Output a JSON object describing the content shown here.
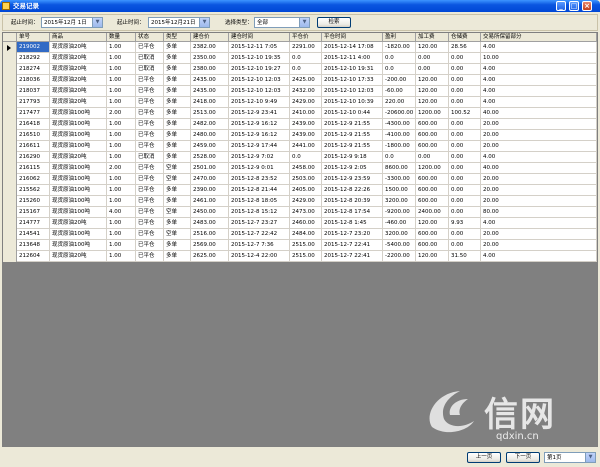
{
  "window": {
    "title": "交易记录",
    "min": "_",
    "max": "□",
    "close": "×"
  },
  "filter": {
    "start_label": "起止时间：",
    "start_value": "2015年12月 1日",
    "end_label": "起止时间：",
    "end_value": "2015年12月21日",
    "type_label": "选择类型：",
    "type_value": "全部",
    "search_label": "检索",
    "arrow": "▼"
  },
  "table": {
    "columns": [
      "单号",
      "商品",
      "数量",
      "状态",
      "类型",
      "建仓价",
      "建仓时间",
      "平仓价",
      "平仓时间",
      "盈利",
      "加工费",
      "仓储费",
      "交易所保留部分"
    ],
    "rows": [
      [
        "219002",
        "现货原油20吨",
        "1.00",
        "已平仓",
        "多单",
        "2382.00",
        "2015-12-11 7:05",
        "2291.00",
        "2015-12-14 17:08",
        "-1820.00",
        "120.00",
        "28.56",
        "4.00"
      ],
      [
        "218292",
        "现货原油20吨",
        "1.00",
        "已取消",
        "多单",
        "2350.00",
        "2015-12-10 19:35",
        "0.0",
        "2015-12-11 4:00",
        "0.0",
        "0.00",
        "0.00",
        "10.00"
      ],
      [
        "218274",
        "现货原油20吨",
        "1.00",
        "已取消",
        "多单",
        "2380.00",
        "2015-12-10 19:27",
        "0.0",
        "2015-12-10 19:31",
        "0.0",
        "0.00",
        "0.00",
        "4.00"
      ],
      [
        "218036",
        "现货原油20吨",
        "1.00",
        "已平仓",
        "多单",
        "2435.00",
        "2015-12-10 12:03",
        "2425.00",
        "2015-12-10 17:33",
        "-200.00",
        "120.00",
        "0.00",
        "4.00"
      ],
      [
        "218037",
        "现货原油20吨",
        "1.00",
        "已平仓",
        "多单",
        "2435.00",
        "2015-12-10 12:03",
        "2432.00",
        "2015-12-10 12:03",
        "-60.00",
        "120.00",
        "0.00",
        "4.00"
      ],
      [
        "217793",
        "现货原油20吨",
        "1.00",
        "已平仓",
        "多单",
        "2418.00",
        "2015-12-10 9:49",
        "2429.00",
        "2015-12-10 10:39",
        "220.00",
        "120.00",
        "0.00",
        "4.00"
      ],
      [
        "217477",
        "现货原油100吨",
        "2.00",
        "已平仓",
        "多单",
        "2513.00",
        "2015-12-9 23:41",
        "2410.00",
        "2015-12-10 0:44",
        "-20600.00",
        "1200.00",
        "100.52",
        "40.00"
      ],
      [
        "216418",
        "现货原油100吨",
        "1.00",
        "已平仓",
        "多单",
        "2482.00",
        "2015-12-9 16:12",
        "2439.00",
        "2015-12-9 21:55",
        "-4300.00",
        "600.00",
        "0.00",
        "20.00"
      ],
      [
        "216510",
        "现货原油100吨",
        "1.00",
        "已平仓",
        "多单",
        "2480.00",
        "2015-12-9 16:12",
        "2439.00",
        "2015-12-9 21:55",
        "-4100.00",
        "600.00",
        "0.00",
        "20.00"
      ],
      [
        "216611",
        "现货原油100吨",
        "1.00",
        "已平仓",
        "多单",
        "2459.00",
        "2015-12-9 17:44",
        "2441.00",
        "2015-12-9 21:55",
        "-1800.00",
        "600.00",
        "0.00",
        "20.00"
      ],
      [
        "216290",
        "现货原油20吨",
        "1.00",
        "已取消",
        "多单",
        "2528.00",
        "2015-12-9 7:02",
        "0.0",
        "2015-12-9 9:18",
        "0.0",
        "0.00",
        "0.00",
        "4.00"
      ],
      [
        "216115",
        "现货原油100吨",
        "2.00",
        "已平仓",
        "空单",
        "2501.00",
        "2015-12-9 0:01",
        "2458.00",
        "2015-12-9 2:05",
        "8600.00",
        "1200.00",
        "0.00",
        "40.00"
      ],
      [
        "216062",
        "现货原油100吨",
        "1.00",
        "已平仓",
        "空单",
        "2470.00",
        "2015-12-8 23:52",
        "2503.00",
        "2015-12-9 23:59",
        "-3300.00",
        "600.00",
        "0.00",
        "20.00"
      ],
      [
        "215562",
        "现货原油100吨",
        "1.00",
        "已平仓",
        "多单",
        "2390.00",
        "2015-12-8 21:44",
        "2405.00",
        "2015-12-8 22:26",
        "1500.00",
        "600.00",
        "0.00",
        "20.00"
      ],
      [
        "215260",
        "现货原油100吨",
        "1.00",
        "已平仓",
        "多单",
        "2461.00",
        "2015-12-8 18:05",
        "2429.00",
        "2015-12-8 20:39",
        "3200.00",
        "600.00",
        "0.00",
        "20.00"
      ],
      [
        "215167",
        "现货原油100吨",
        "4.00",
        "已平仓",
        "空单",
        "2450.00",
        "2015-12-8 15:12",
        "2473.00",
        "2015-12-8 17:54",
        "-9200.00",
        "2400.00",
        "0.00",
        "80.00"
      ],
      [
        "214777",
        "现货原油20吨",
        "1.00",
        "已平仓",
        "多单",
        "2483.00",
        "2015-12-7 23:27",
        "2460.00",
        "2015-12-8 1:45",
        "-460.00",
        "120.00",
        "9.93",
        "4.00"
      ],
      [
        "214541",
        "现货原油100吨",
        "1.00",
        "已平仓",
        "空单",
        "2516.00",
        "2015-12-7 22:42",
        "2484.00",
        "2015-12-7 23:20",
        "3200.00",
        "600.00",
        "0.00",
        "20.00"
      ],
      [
        "213648",
        "现货原油100吨",
        "1.00",
        "已平仓",
        "多单",
        "2569.00",
        "2015-12-7 7:36",
        "2515.00",
        "2015-12-7 22:41",
        "-5400.00",
        "600.00",
        "0.00",
        "20.00"
      ],
      [
        "212604",
        "现货原油20吨",
        "1.00",
        "已平仓",
        "多单",
        "2625.00",
        "2015-12-4 22:00",
        "2515.00",
        "2015-12-7 22:41",
        "-2200.00",
        "120.00",
        "31.50",
        "4.00"
      ]
    ]
  },
  "watermark": {
    "brand": "信网",
    "url": "qdxin.cn"
  },
  "pager": {
    "prev": "上一页",
    "next": "下一页",
    "page": "第1页",
    "arrow": "▼"
  }
}
